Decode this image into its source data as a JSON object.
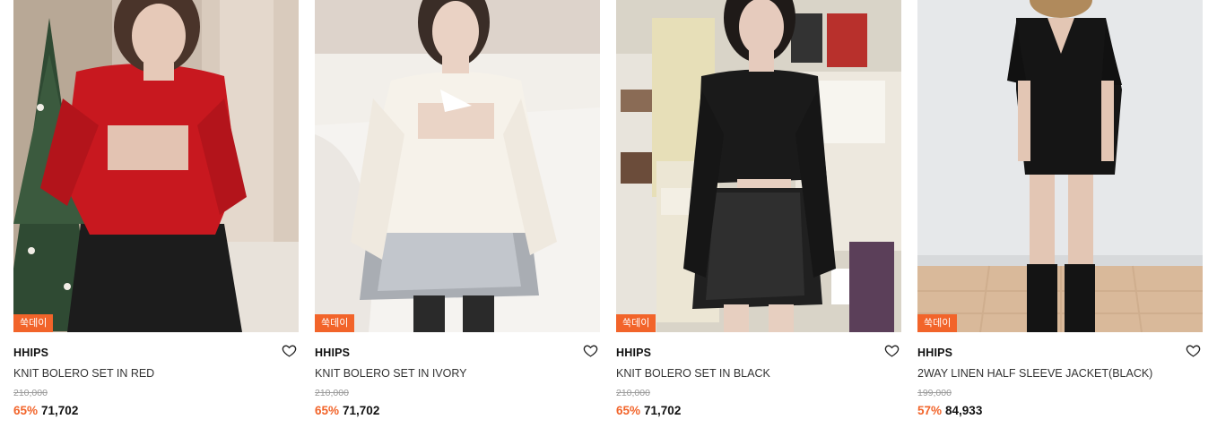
{
  "products": [
    {
      "badge": "쑥데이",
      "brand": "HHIPS",
      "name": "KNIT BOLERO SET IN RED",
      "original_price": "210,000",
      "discount": "65%",
      "price": "71,702",
      "wishlist_icon": "heart-outline-icon",
      "image_subject": "model in red knit bolero set with black leather skirt beside Christmas tree"
    },
    {
      "badge": "쑥데이",
      "brand": "HHIPS",
      "name": "KNIT BOLERO SET IN IVORY",
      "original_price": "210,000",
      "discount": "65%",
      "price": "71,702",
      "wishlist_icon": "heart-outline-icon",
      "image_subject": "model in ivory knit bolero set with silver skirt seated on bed"
    },
    {
      "badge": "쑥데이",
      "brand": "HHIPS",
      "name": "KNIT BOLERO SET IN BLACK",
      "original_price": "210,000",
      "discount": "65%",
      "price": "71,702",
      "wishlist_icon": "heart-outline-icon",
      "image_subject": "model in black knit bolero set with black leather skirt in kitchen"
    },
    {
      "badge": "쑥데이",
      "brand": "HHIPS",
      "name": "2WAY LINEN HALF SLEEVE JACKET(BLACK)",
      "original_price": "199,000",
      "discount": "57%",
      "price": "84,933",
      "wishlist_icon": "heart-outline-icon",
      "image_subject": "model in black linen half sleeve jacket with black rain boots"
    }
  ],
  "colors": {
    "accent": "#f2642a",
    "text": "#111111",
    "muted": "#9a9a9a"
  }
}
